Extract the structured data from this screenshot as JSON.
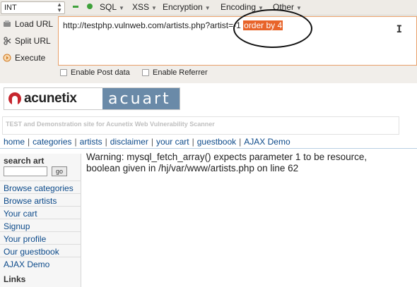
{
  "hackbar": {
    "select_value": "INT",
    "menus": [
      {
        "label": "SQL"
      },
      {
        "label": "XSS"
      },
      {
        "label": "Encryption"
      },
      {
        "label": "Encoding"
      },
      {
        "label": "Other"
      }
    ],
    "side_buttons": {
      "load_url": "Load URL",
      "split_url": "Split URL",
      "execute": "Execute"
    },
    "url_text": "http://testphp.vulnweb.com/artists.php?artist=-1 ",
    "url_selected": "order by 4",
    "enable_post": "Enable Post data",
    "enable_referrer": "Enable Referrer",
    "accent_color": "#e8642a"
  },
  "site": {
    "logo_left": "acunetix",
    "logo_right": "acuart",
    "tagline": "TEST and Demonstration site for Acunetix Web Vulnerability Scanner",
    "nav": [
      "home",
      "categories",
      "artists",
      "disclaimer",
      "your cart",
      "guestbook",
      "AJAX Demo"
    ],
    "sidebar": {
      "search_title": "search art",
      "search_button": "go",
      "links": [
        "Browse categories",
        "Browse artists",
        "Your cart",
        "Signup",
        "Your profile",
        "Our guestbook",
        "AJAX Demo"
      ],
      "links_title": "Links"
    },
    "warning": "Warning: mysql_fetch_array() expects parameter 1 to be resource, boolean given in /hj/var/www/artists.php on line 62"
  }
}
